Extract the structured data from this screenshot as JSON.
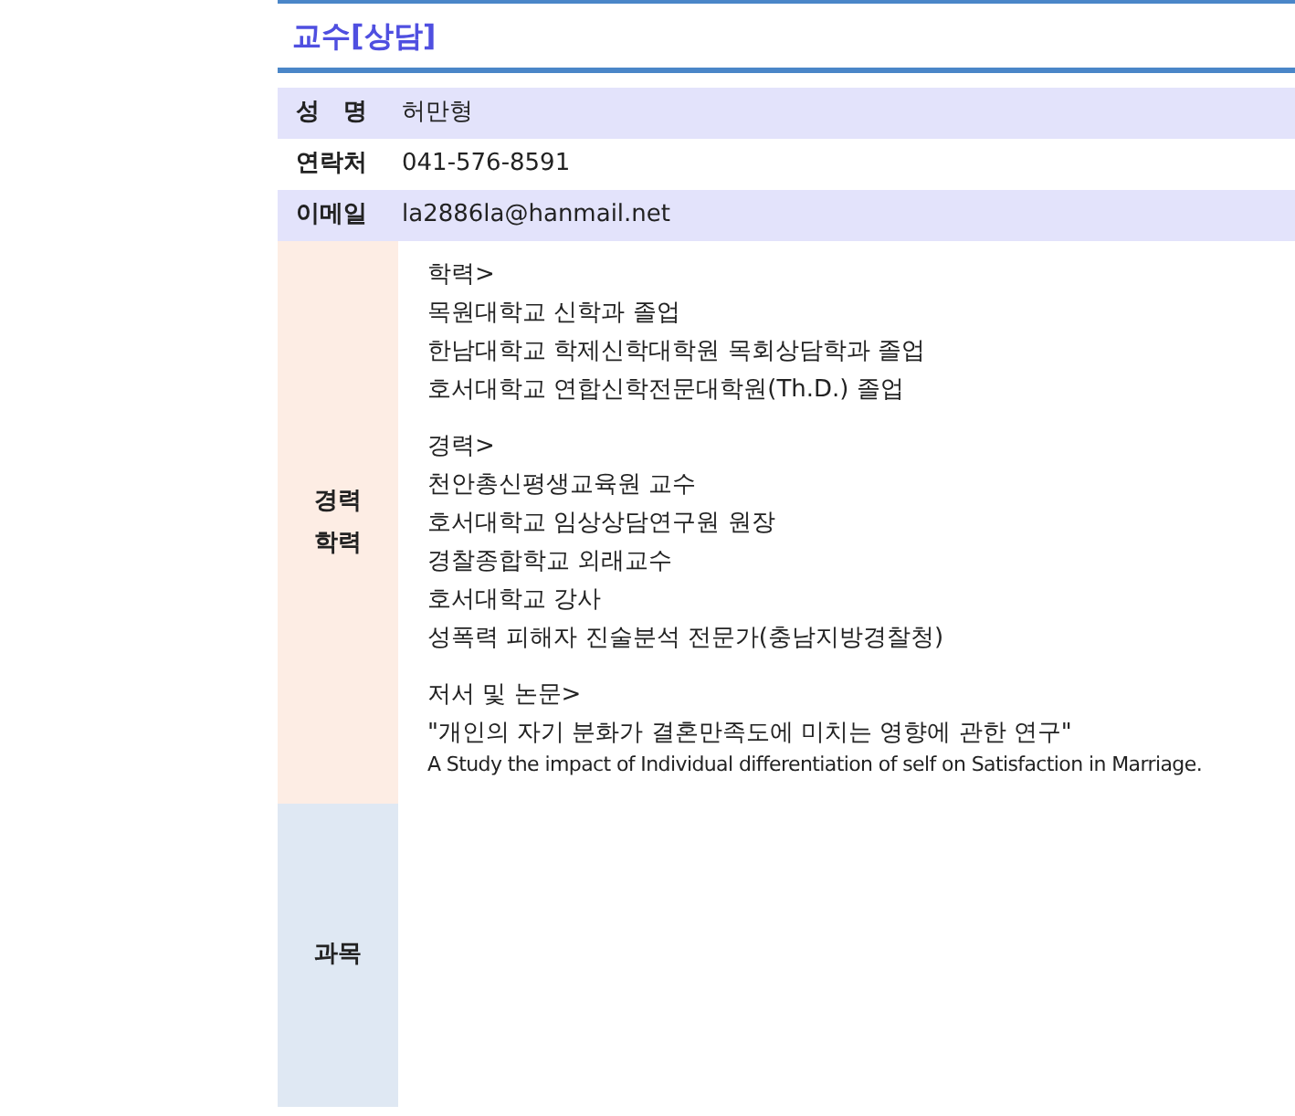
{
  "title": "교수[상담]",
  "info_rows": [
    {
      "label": "성　명",
      "value": "허만형",
      "shaded": true
    },
    {
      "label": "연락처",
      "value": "041-576-8591",
      "shaded": false
    },
    {
      "label": "이메일",
      "value": "la2886la@hanmail.net",
      "shaded": true
    }
  ],
  "career": {
    "label_lines": [
      "경력",
      "학력"
    ],
    "sections": [
      {
        "heading": "학력>",
        "lines": [
          {
            "text": "목원대학교 신학과 졸업",
            "kind": "normal"
          },
          {
            "text": "한남대학교 학제신학대학원 목회상담학과 졸업",
            "kind": "normal"
          },
          {
            "text": "호서대학교 연합신학전문대학원(Th.D.) 졸업",
            "kind": "normal"
          }
        ]
      },
      {
        "heading": "경력>",
        "lines": [
          {
            "text": "천안총신평생교육원 교수",
            "kind": "normal"
          },
          {
            "text": "호서대학교 임상상담연구원 원장",
            "kind": "normal"
          },
          {
            "text": "경찰종합학교 외래교수",
            "kind": "normal"
          },
          {
            "text": "호서대학교 강사",
            "kind": "normal"
          },
          {
            "text": "성폭력 피해자 진술분석 전문가(충남지방경찰청)",
            "kind": "normal"
          }
        ]
      },
      {
        "heading": "저서 및 논문>",
        "lines": [
          {
            "text": "\"개인의 자기 분화가 결혼만족도에 미치는 영향에 관한 연구\"",
            "kind": "normal"
          },
          {
            "text": "A Study the impact of Individual differentiation of self on Satisfaction in Marriage.",
            "kind": "small"
          }
        ]
      }
    ]
  },
  "courses": {
    "label": "과목"
  }
}
